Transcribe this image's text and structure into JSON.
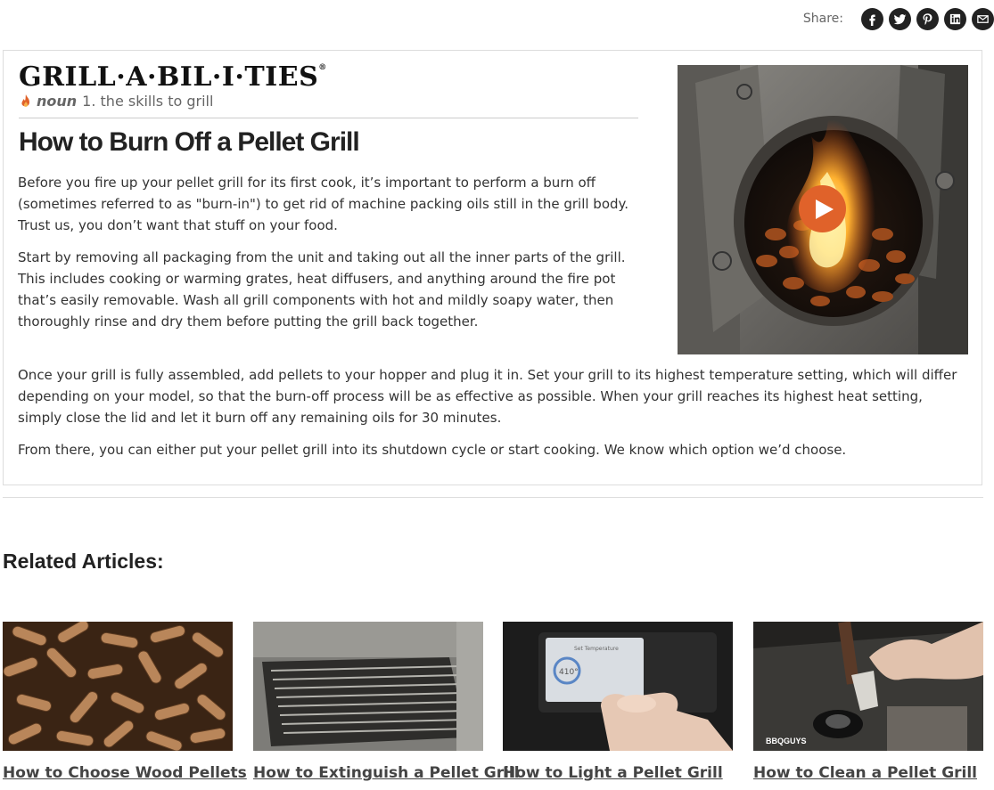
{
  "share": {
    "label": "Share:",
    "buttons": [
      {
        "name": "facebook-icon"
      },
      {
        "name": "twitter-icon"
      },
      {
        "name": "pinterest-icon"
      },
      {
        "name": "linkedin-icon"
      },
      {
        "name": "email-icon"
      }
    ]
  },
  "logo": {
    "text": "GRILL·A·BIL·I·TIES",
    "registered": "®"
  },
  "definition": {
    "icon": "flame-icon",
    "part_of_speech": "noun",
    "meaning": "1. the skills to grill"
  },
  "article": {
    "title": "How to Burn Off a Pellet Grill",
    "paragraphs": [
      "Before you fire up your pellet grill for its first cook, it’s important to perform a burn off (sometimes referred to as \"burn-in\") to get rid of machine packing oils still in the grill body. Trust us, you don’t want that stuff on your food.",
      "Start by removing all packaging from the unit and taking out all the inner parts of the grill. This includes cooking or warming grates, heat diffusers, and anything around the fire pot that’s easily removable. Wash all grill components with hot and mildly soapy water, then thoroughly rinse and dry them before putting the grill back together.",
      "Once your grill is fully assembled, add pellets to your hopper and plug it in. Set your grill to its highest temperature setting, which will differ depending on your model, so that the burn-off process will be as effective as possible. When your grill reaches its highest heat setting, simply close the lid and let it burn off any remaining oils for 30 minutes.",
      "From there, you can either put your pellet grill into its shutdown cycle or start cooking. We know which option we’d choose."
    ]
  },
  "video": {
    "play_icon": "play-icon",
    "accent": "#e0622a"
  },
  "related": {
    "heading": "Related Articles:",
    "items": [
      {
        "title": "How to Choose Wood Pellets"
      },
      {
        "title": "How to Extinguish a Pellet Grill"
      },
      {
        "title": "How to Light a Pellet Grill",
        "screen_temp": "410°",
        "screen_title": "Set Temperature"
      },
      {
        "title": "How to Clean a Pellet Grill",
        "watermark": "BBQGUYS"
      }
    ]
  }
}
